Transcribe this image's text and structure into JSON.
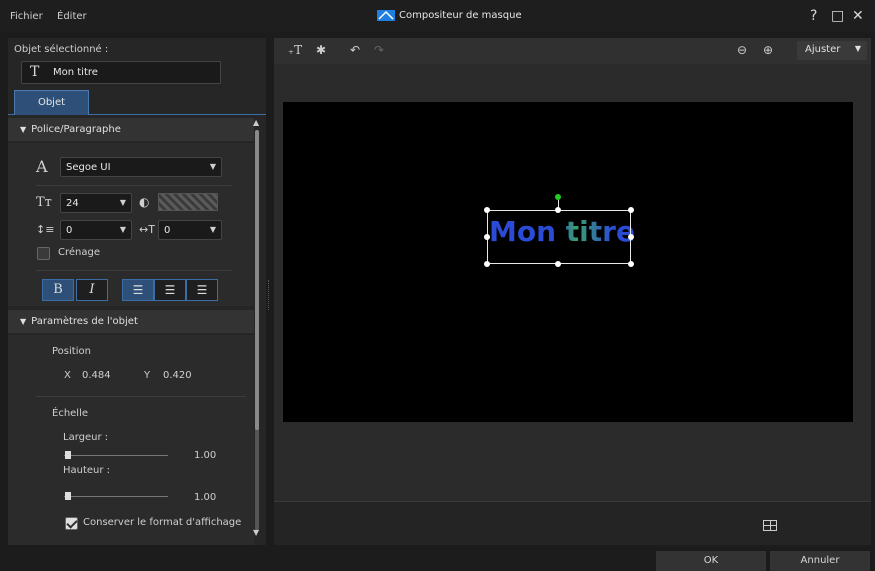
{
  "window": {
    "title": "Compositeur de masque",
    "menu": [
      "Fichier",
      "Éditer"
    ],
    "controls": {
      "help": "?",
      "maximize": "□",
      "close": "✕"
    },
    "accent": "#3a6ea5"
  },
  "left": {
    "selected_label": "Objet sélectionné :",
    "selected_value": "Mon titre",
    "tab": "Objet",
    "font_section": {
      "header": "Police/Paragraphe",
      "font_family": "Segoe UI",
      "font_size": "24",
      "line_spacing": "0",
      "char_spacing": "0",
      "kerning_label": "Crénage",
      "bold": "B",
      "italic": "I"
    },
    "object_section": {
      "header": "Paramètres de l'objet",
      "position_label": "Position",
      "x_label": "X",
      "x_value": "0.484",
      "y_label": "Y",
      "y_value": "0.420",
      "scale_label": "Échelle",
      "width_label": "Largeur :",
      "width_value": "1.00",
      "height_label": "Hauteur :",
      "height_value": "1.00",
      "keep_ratio_label": "Conserver le format d'affichage"
    }
  },
  "right": {
    "zoom_label": "Ajuster",
    "canvas_text": "Mon titre"
  },
  "footer": {
    "ok": "OK",
    "cancel": "Annuler"
  }
}
